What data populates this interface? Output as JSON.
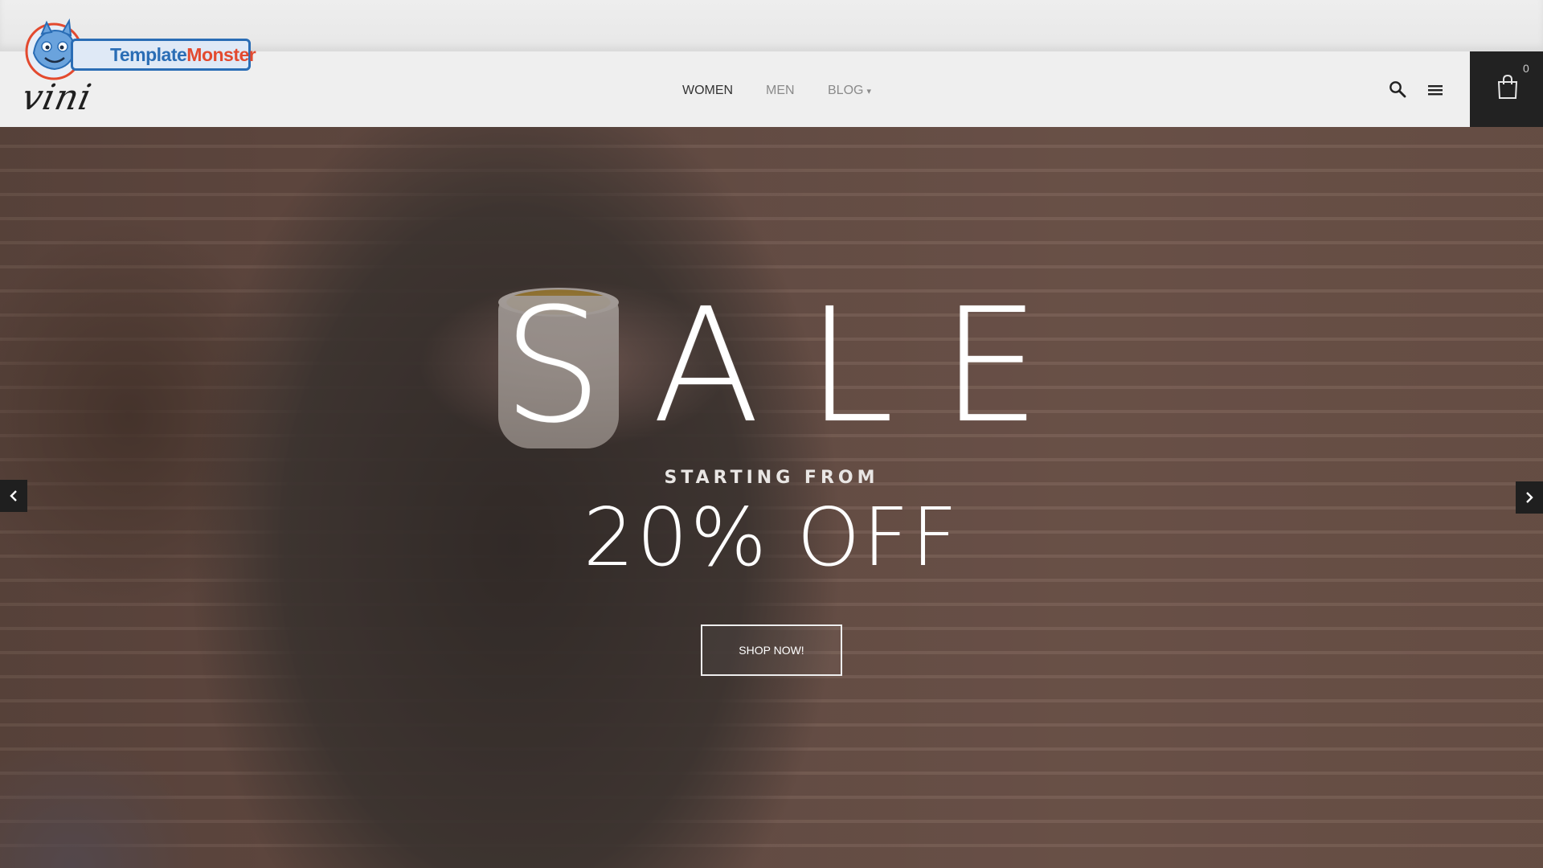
{
  "watermark": {
    "brand_part1": "Template",
    "brand_part2": "Monster"
  },
  "brand": {
    "logo_text": "vini"
  },
  "nav": {
    "items": [
      {
        "label": "WOMEN",
        "active": true
      },
      {
        "label": "MEN",
        "active": false
      },
      {
        "label": "BLOG",
        "active": false
      }
    ],
    "blog_caret": "▾"
  },
  "header_icons": {
    "search": "search-icon",
    "menu": "menu-icon",
    "cart": "shopping-bag-icon"
  },
  "cart": {
    "count": "0"
  },
  "hero": {
    "title": "SALE",
    "subtitle": "STARTING FROM",
    "discount": "20% OFF",
    "cta_label": "SHOP NOW!",
    "prev_icon": "chevron-left-icon",
    "next_icon": "chevron-right-icon"
  },
  "colors": {
    "header_bg": "#efefef",
    "cart_bg": "#222222",
    "nav_active": "#333333",
    "nav_inactive": "#8a8a8a",
    "hero_text": "#ffffff",
    "tm_blue": "#2a6db5",
    "tm_red": "#e34a2f"
  }
}
